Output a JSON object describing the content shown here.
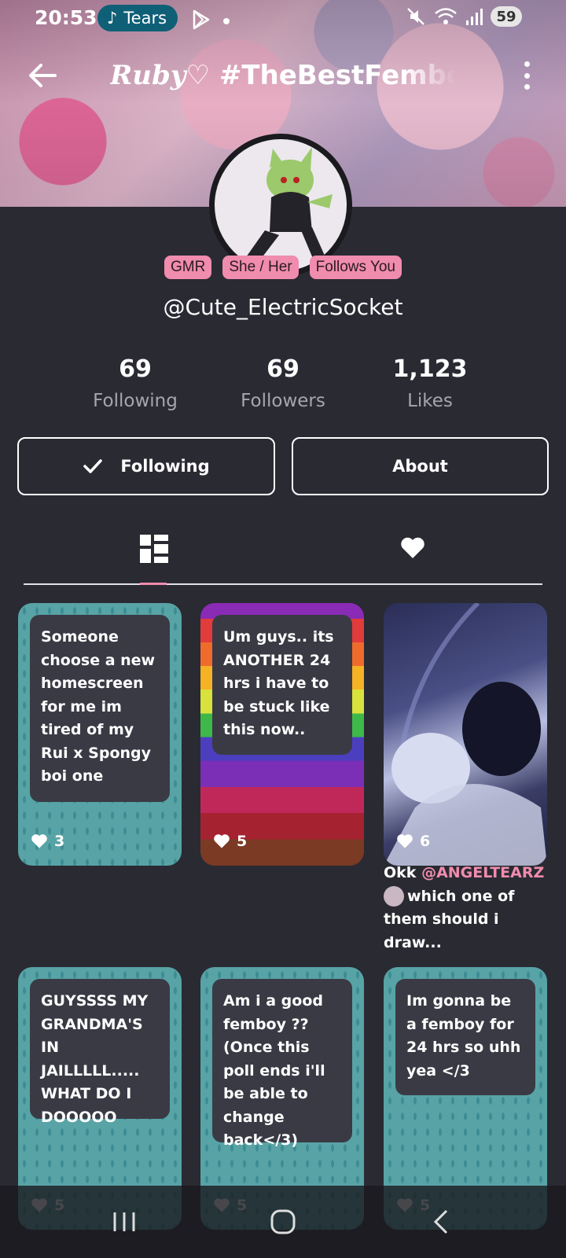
{
  "status_bar": {
    "time": "20:53",
    "music_label": "Tears",
    "battery": "59"
  },
  "header": {
    "title_script": "Ruby♡",
    "title": "#TheBestFemboy"
  },
  "profile": {
    "badges": [
      "GMR",
      "She / Her",
      "Follows You"
    ],
    "username": "@Cute_ElectricSocket",
    "stats": [
      {
        "value": "69",
        "label": "Following"
      },
      {
        "value": "69",
        "label": "Followers"
      },
      {
        "value": "1,123",
        "label": "Likes"
      }
    ],
    "following_button": "Following",
    "about_button": "About"
  },
  "posts": [
    {
      "text": "Someone choose a new homescreen for me im tired of my Rui x Spongy boi one",
      "likes": "3"
    },
    {
      "text": "Um guys.. its ANOTHER 24 hrs i have to be stuck like this now..",
      "likes": "5"
    },
    {
      "likes": "6",
      "caption_pre": "Okk",
      "caption_mention": "@ANGELTEARZ",
      "caption_post": "which one of them should i draw..."
    },
    {
      "text": "GUYSSSS MY GRANDMA'S IN JAILLLLL..... WHAT DO I DOOOOO",
      "likes": "5"
    },
    {
      "text": "Am i a good femboy ?? (Once this poll ends i'll be able to change back</3)",
      "likes": "5"
    },
    {
      "text": "Im gonna be a femboy for 24 hrs so uhh yea </3",
      "likes": "5"
    }
  ],
  "colors": {
    "accent": "#f08cad",
    "background": "#2a2a33",
    "card_teal": "#58a3a6"
  }
}
